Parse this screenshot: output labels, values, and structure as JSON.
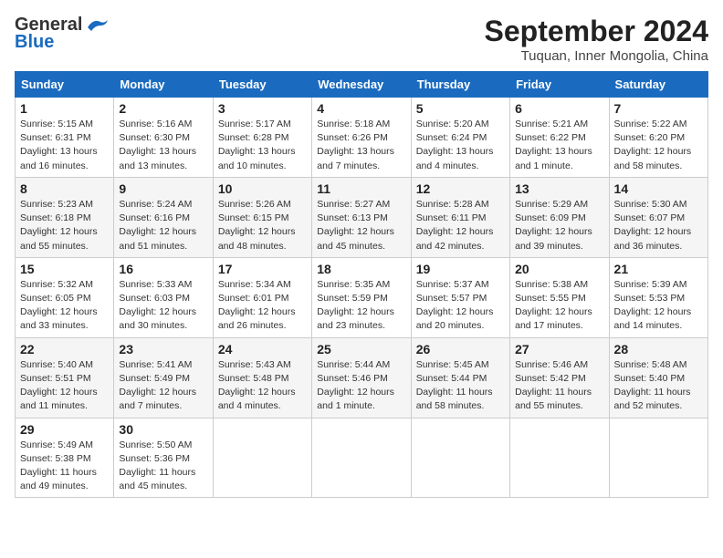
{
  "header": {
    "logo_line1": "General",
    "logo_line2": "Blue",
    "month": "September 2024",
    "location": "Tuquan, Inner Mongolia, China"
  },
  "weekdays": [
    "Sunday",
    "Monday",
    "Tuesday",
    "Wednesday",
    "Thursday",
    "Friday",
    "Saturday"
  ],
  "weeks": [
    [
      {
        "day": 1,
        "info": "Sunrise: 5:15 AM\nSunset: 6:31 PM\nDaylight: 13 hours\nand 16 minutes."
      },
      {
        "day": 2,
        "info": "Sunrise: 5:16 AM\nSunset: 6:30 PM\nDaylight: 13 hours\nand 13 minutes."
      },
      {
        "day": 3,
        "info": "Sunrise: 5:17 AM\nSunset: 6:28 PM\nDaylight: 13 hours\nand 10 minutes."
      },
      {
        "day": 4,
        "info": "Sunrise: 5:18 AM\nSunset: 6:26 PM\nDaylight: 13 hours\nand 7 minutes."
      },
      {
        "day": 5,
        "info": "Sunrise: 5:20 AM\nSunset: 6:24 PM\nDaylight: 13 hours\nand 4 minutes."
      },
      {
        "day": 6,
        "info": "Sunrise: 5:21 AM\nSunset: 6:22 PM\nDaylight: 13 hours\nand 1 minute."
      },
      {
        "day": 7,
        "info": "Sunrise: 5:22 AM\nSunset: 6:20 PM\nDaylight: 12 hours\nand 58 minutes."
      }
    ],
    [
      {
        "day": 8,
        "info": "Sunrise: 5:23 AM\nSunset: 6:18 PM\nDaylight: 12 hours\nand 55 minutes."
      },
      {
        "day": 9,
        "info": "Sunrise: 5:24 AM\nSunset: 6:16 PM\nDaylight: 12 hours\nand 51 minutes."
      },
      {
        "day": 10,
        "info": "Sunrise: 5:26 AM\nSunset: 6:15 PM\nDaylight: 12 hours\nand 48 minutes."
      },
      {
        "day": 11,
        "info": "Sunrise: 5:27 AM\nSunset: 6:13 PM\nDaylight: 12 hours\nand 45 minutes."
      },
      {
        "day": 12,
        "info": "Sunrise: 5:28 AM\nSunset: 6:11 PM\nDaylight: 12 hours\nand 42 minutes."
      },
      {
        "day": 13,
        "info": "Sunrise: 5:29 AM\nSunset: 6:09 PM\nDaylight: 12 hours\nand 39 minutes."
      },
      {
        "day": 14,
        "info": "Sunrise: 5:30 AM\nSunset: 6:07 PM\nDaylight: 12 hours\nand 36 minutes."
      }
    ],
    [
      {
        "day": 15,
        "info": "Sunrise: 5:32 AM\nSunset: 6:05 PM\nDaylight: 12 hours\nand 33 minutes."
      },
      {
        "day": 16,
        "info": "Sunrise: 5:33 AM\nSunset: 6:03 PM\nDaylight: 12 hours\nand 30 minutes."
      },
      {
        "day": 17,
        "info": "Sunrise: 5:34 AM\nSunset: 6:01 PM\nDaylight: 12 hours\nand 26 minutes."
      },
      {
        "day": 18,
        "info": "Sunrise: 5:35 AM\nSunset: 5:59 PM\nDaylight: 12 hours\nand 23 minutes."
      },
      {
        "day": 19,
        "info": "Sunrise: 5:37 AM\nSunset: 5:57 PM\nDaylight: 12 hours\nand 20 minutes."
      },
      {
        "day": 20,
        "info": "Sunrise: 5:38 AM\nSunset: 5:55 PM\nDaylight: 12 hours\nand 17 minutes."
      },
      {
        "day": 21,
        "info": "Sunrise: 5:39 AM\nSunset: 5:53 PM\nDaylight: 12 hours\nand 14 minutes."
      }
    ],
    [
      {
        "day": 22,
        "info": "Sunrise: 5:40 AM\nSunset: 5:51 PM\nDaylight: 12 hours\nand 11 minutes."
      },
      {
        "day": 23,
        "info": "Sunrise: 5:41 AM\nSunset: 5:49 PM\nDaylight: 12 hours\nand 7 minutes."
      },
      {
        "day": 24,
        "info": "Sunrise: 5:43 AM\nSunset: 5:48 PM\nDaylight: 12 hours\nand 4 minutes."
      },
      {
        "day": 25,
        "info": "Sunrise: 5:44 AM\nSunset: 5:46 PM\nDaylight: 12 hours\nand 1 minute."
      },
      {
        "day": 26,
        "info": "Sunrise: 5:45 AM\nSunset: 5:44 PM\nDaylight: 11 hours\nand 58 minutes."
      },
      {
        "day": 27,
        "info": "Sunrise: 5:46 AM\nSunset: 5:42 PM\nDaylight: 11 hours\nand 55 minutes."
      },
      {
        "day": 28,
        "info": "Sunrise: 5:48 AM\nSunset: 5:40 PM\nDaylight: 11 hours\nand 52 minutes."
      }
    ],
    [
      {
        "day": 29,
        "info": "Sunrise: 5:49 AM\nSunset: 5:38 PM\nDaylight: 11 hours\nand 49 minutes."
      },
      {
        "day": 30,
        "info": "Sunrise: 5:50 AM\nSunset: 5:36 PM\nDaylight: 11 hours\nand 45 minutes."
      },
      null,
      null,
      null,
      null,
      null
    ]
  ]
}
